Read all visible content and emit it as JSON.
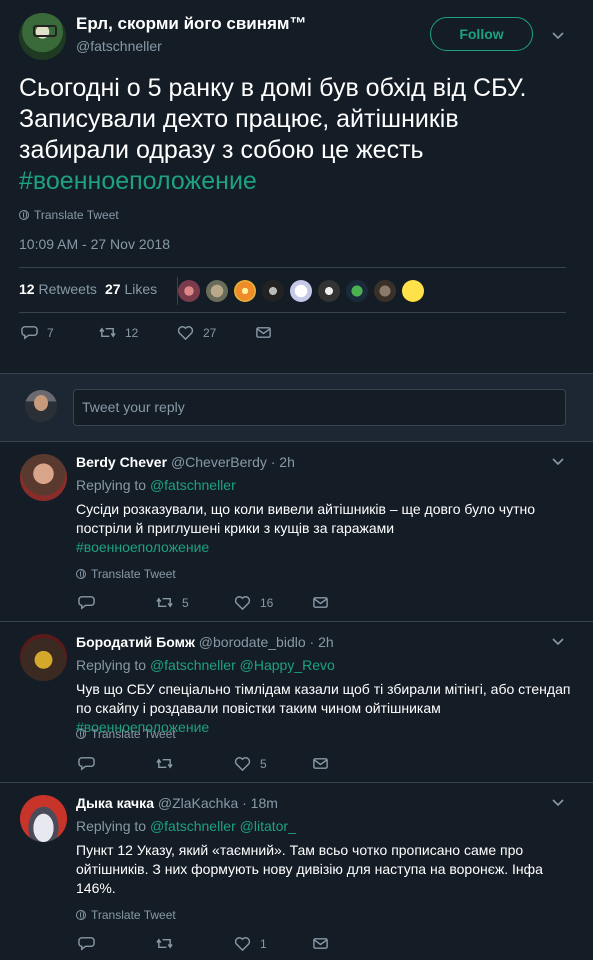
{
  "colors": {
    "background": "#141d26",
    "accent": "#1da17f",
    "muted": "#8899a6",
    "border": "#38444d"
  },
  "tweet": {
    "author_name": "Ерл, скорми його свиням™",
    "author_handle": "@fatschneller",
    "follow_label": "Follow",
    "text_lines": [
      "Сьогодні о 5 ранку в домі був обхід від СБУ.",
      "Записували дехто працює, айтішників",
      "забирали одразу з собою це жесть"
    ],
    "hashtag": "#военноеположение",
    "translate_label": "Translate Tweet",
    "timestamp": "10:09 AM - 27 Nov 2018",
    "retweets_count": "12",
    "retweets_label": "Retweets",
    "likes_count": "27",
    "likes_label": "Likes",
    "action_reply_count": "7",
    "action_retweet_count": "12",
    "action_like_count": "27"
  },
  "reply_box": {
    "placeholder": "Tweet your reply"
  },
  "replies": [
    {
      "name": "Berdy Chever",
      "handle": "@CheverBerdy",
      "time": "· 2h",
      "replying_label": "Replying to",
      "replying_to": "@fatschneller",
      "replying_to_2": "",
      "text": "Сусіди розказували, що коли вивели айтішників – ще довго було чутно постріли й приглушені крики з кущів за гаражами",
      "hashtag": "#военноеположение",
      "translate_label": "Translate Tweet",
      "reply_count": "",
      "retweet_count": "5",
      "like_count": "16"
    },
    {
      "name": "Бородатий Бомж",
      "handle": "@borodate_bidlo",
      "time": "· 2h",
      "replying_label": "Replying to",
      "replying_to": "@fatschneller",
      "replying_to_2": "@Happy_Revo",
      "text": "Чув що СБУ спеціально тімлідам казали щоб ті збирали мітінгі, або стендап по скайпу і роздавали повістки таким чином ойтішникам",
      "hashtag": "#военноеположение",
      "translate_label": "Translate Tweet",
      "reply_count": "",
      "retweet_count": "",
      "like_count": "5"
    },
    {
      "name": "Дыка качка",
      "handle": "@ZlaKachka",
      "time": "· 18m",
      "replying_label": "Replying to",
      "replying_to": "@fatschneller",
      "replying_to_2": "@litator_",
      "text": "Пункт 12 Указу, який «таємний». Там всьо чотко прописано саме про ойтішників. З них формують нову дивізію для наступа на воронєж. Інфа 146%.",
      "hashtag": "",
      "translate_label": "Translate Tweet",
      "reply_count": "",
      "retweet_count": "",
      "like_count": "1"
    }
  ]
}
